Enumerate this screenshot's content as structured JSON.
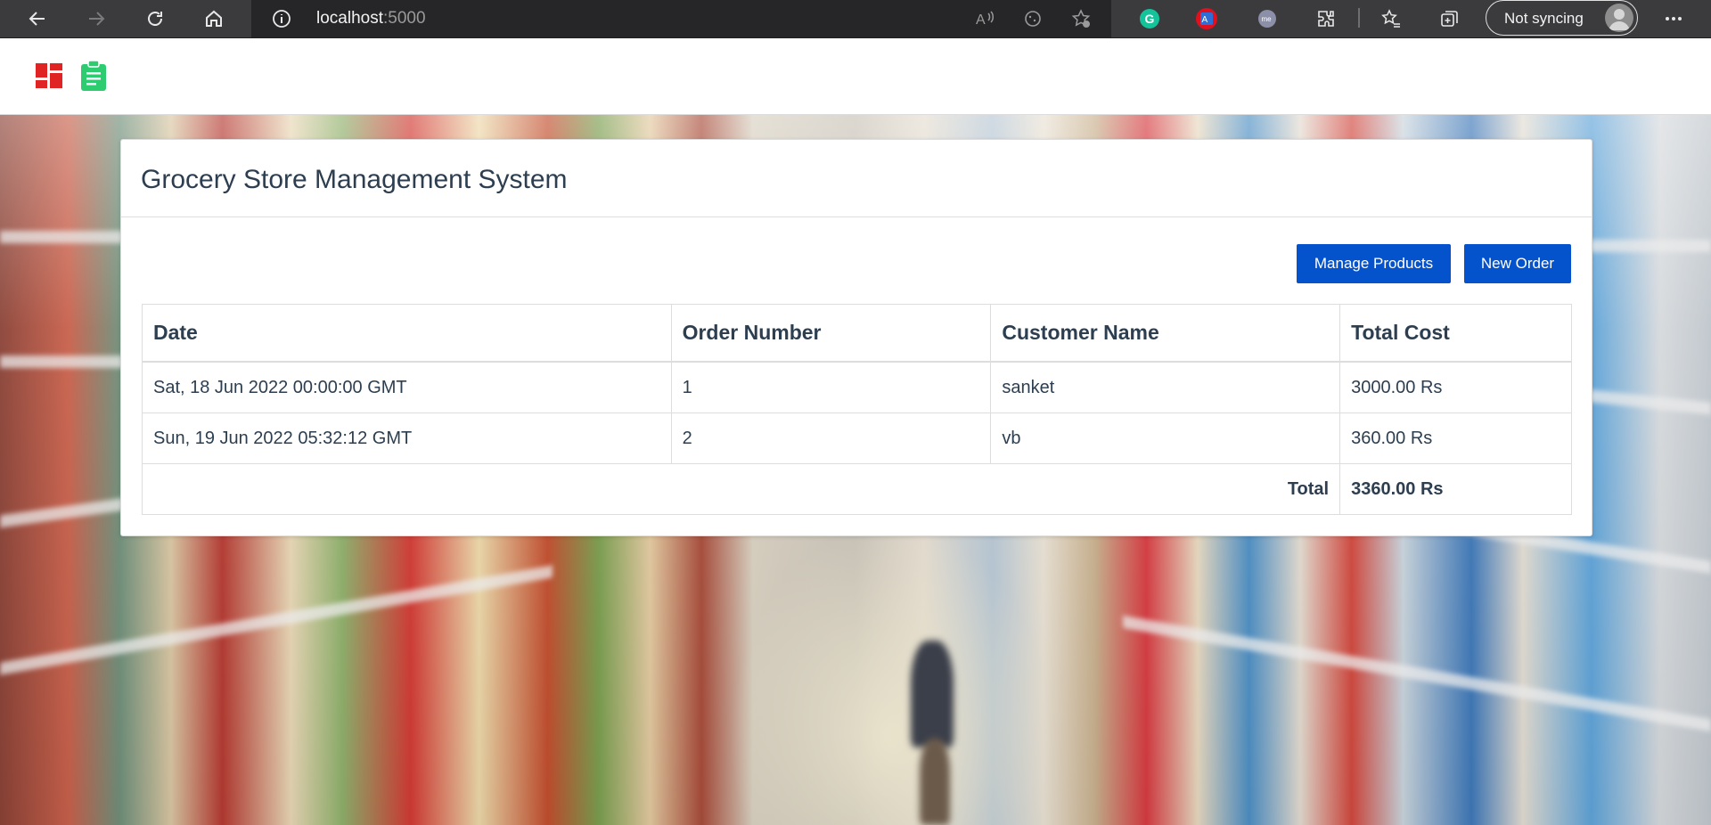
{
  "browser": {
    "url_host": "localhost",
    "url_port": ":5000",
    "sync_label": "Not syncing",
    "toolbar_icons": [
      "back-icon",
      "forward-icon",
      "refresh-icon",
      "home-icon",
      "read-aloud-icon",
      "cookie-icon",
      "add-favorite-icon",
      "grammarly-icon",
      "translate-icon",
      "extension-me-icon",
      "extensions-icon",
      "favorites-icon",
      "collections-icon",
      "more-icon"
    ]
  },
  "app": {
    "header_icons": [
      "dashboard-icon",
      "clipboard-icon"
    ],
    "brand_colors": {
      "dashboard": "#e02424",
      "clipboard": "#2ecc71",
      "primary_button": "#0452cc"
    }
  },
  "card": {
    "title": "Grocery Store Management System",
    "manage_products_label": "Manage Products",
    "new_order_label": "New Order"
  },
  "table": {
    "headers": {
      "date": "Date",
      "order_number": "Order Number",
      "customer_name": "Customer Name",
      "total_cost": "Total Cost"
    },
    "rows": [
      {
        "date": "Sat, 18 Jun 2022 00:00:00 GMT",
        "order_number": "1",
        "customer_name": "sanket",
        "total_cost": "3000.00 Rs"
      },
      {
        "date": "Sun, 19 Jun 2022 05:32:12 GMT",
        "order_number": "2",
        "customer_name": "vb",
        "total_cost": "360.00 Rs"
      }
    ],
    "total_label": "Total",
    "total_value": "3360.00 Rs"
  }
}
